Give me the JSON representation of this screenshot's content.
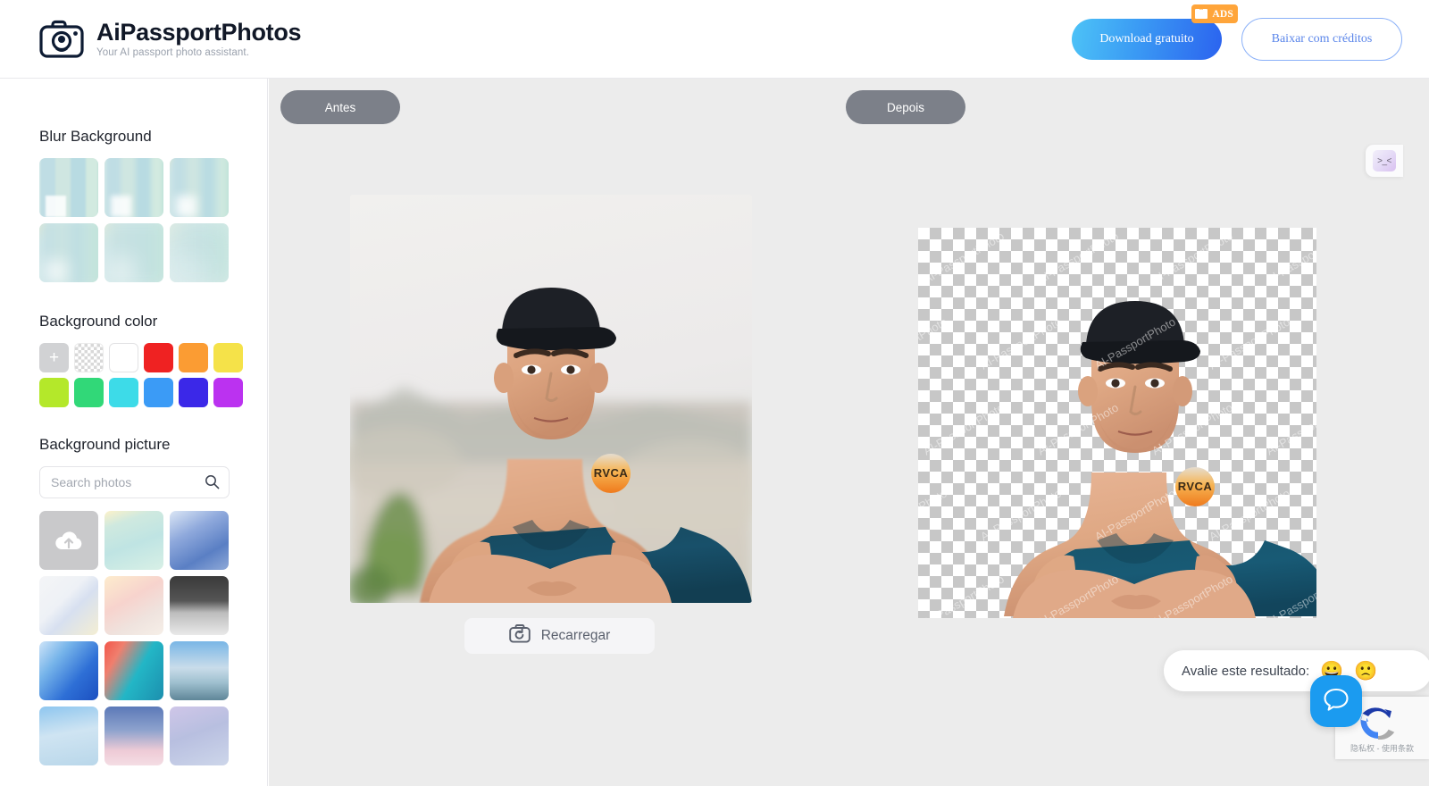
{
  "header": {
    "brand_title": "AiPassportPhotos",
    "brand_subtitle": "Your AI passport photo assistant.",
    "logo_icon": "camera-icon",
    "download_free_label": "Download gratuito",
    "ads_badge_label": "ADS",
    "ads_badge_icon": "tv-icon",
    "download_credits_label": "Baixar com créditos",
    "accent_gradient_from": "#4dc3f7",
    "accent_gradient_to": "#2b63ef",
    "credits_border_color": "#8ab0f8",
    "ads_badge_color": "#ffa53a"
  },
  "sidebar": {
    "blur": {
      "title": "Blur Background",
      "thumbs": [
        {
          "name": "blur-level-1",
          "blur": "1px"
        },
        {
          "name": "blur-level-2",
          "blur": "3px"
        },
        {
          "name": "blur-level-3",
          "blur": "5px"
        },
        {
          "name": "blur-level-4",
          "blur": "9px"
        },
        {
          "name": "blur-level-5",
          "blur": "13px"
        },
        {
          "name": "blur-level-6",
          "blur": "18px"
        }
      ]
    },
    "background_color": {
      "title": "Background color",
      "add_label": "+",
      "swatches": [
        {
          "name": "add-custom-color",
          "type": "add",
          "color": "#d1d2d4"
        },
        {
          "name": "transparent",
          "type": "transparent",
          "color": "transparent"
        },
        {
          "name": "white",
          "type": "solid",
          "color": "#ffffff"
        },
        {
          "name": "red",
          "type": "solid",
          "color": "#ef2222"
        },
        {
          "name": "orange",
          "type": "solid",
          "color": "#fb9c33"
        },
        {
          "name": "yellow",
          "type": "solid",
          "color": "#f5e249"
        },
        {
          "name": "lime",
          "type": "solid",
          "color": "#b4e82a"
        },
        {
          "name": "green",
          "type": "solid",
          "color": "#31d878"
        },
        {
          "name": "cyan",
          "type": "solid",
          "color": "#3ddbe8"
        },
        {
          "name": "blue",
          "type": "solid",
          "color": "#3b9bf6"
        },
        {
          "name": "indigo",
          "type": "solid",
          "color": "#3b28e8"
        },
        {
          "name": "magenta",
          "type": "solid",
          "color": "#bb32f0"
        }
      ]
    },
    "background_picture": {
      "title": "Background picture",
      "search_placeholder": "Search photos",
      "search_value": "",
      "search_icon": "magnifier-icon",
      "upload_icon": "cloud-upload-icon",
      "pictures": [
        {
          "name": "upload-tile",
          "type": "upload"
        },
        {
          "name": "pastel-mint-texture",
          "type": "image",
          "css": "linear-gradient(160deg,#fdf2c9 0%,#cfe9df 22%,#bfe4e3 55%,#d8f0e6 100%)"
        },
        {
          "name": "blue-watercolor",
          "type": "image",
          "css": "linear-gradient(150deg,#dbe6f5 0%,#8fa9dc 35%,#5a7fc4 70%,#8fa9d8 100%)"
        },
        {
          "name": "cream-paper-abstract",
          "type": "image",
          "css": "linear-gradient(135deg,#f4f5f7 0%,#eef1f6 40%,#d7e0f0 58%,#f4eed3 100%)"
        },
        {
          "name": "pink-clouds",
          "type": "image",
          "css": "linear-gradient(150deg,#fdeccd 0%,#f7d3cd 40%,#efe3de 70%,#f6efe8 100%)"
        },
        {
          "name": "dark-grain-gradient",
          "type": "image",
          "css": "linear-gradient(180deg,#3a3a3a 0%,#555 42%,#bcbcbc 62%,#e9e9e9 100%)"
        },
        {
          "name": "blue-ink-wash",
          "type": "image",
          "css": "linear-gradient(130deg,#cfe4f8 0%,#76b4ea 30%,#2e6fd6 65%,#1b4fc0 100%)"
        },
        {
          "name": "coral-teal-paint",
          "type": "image",
          "css": "linear-gradient(120deg,#f2574b 0%,#f07f6e 22%,#23b6c6 55%,#1c8fae 100%)"
        },
        {
          "name": "sky-clouds-lake",
          "type": "image",
          "css": "linear-gradient(180deg,#79b6e6 0%,#c9dcea 45%,#9fc0cf 70%,#5f8698 100%)"
        },
        {
          "name": "rainbow-sky",
          "type": "image",
          "css": "linear-gradient(170deg,#8ec6ef 0%,#cfe4f2 45%,#b9d7ea 100%)"
        },
        {
          "name": "pink-cloud-dusk",
          "type": "image",
          "css": "linear-gradient(180deg,#5c79b8 0%,#8da2cd 40%,#eecbd6 75%,#f4dde4 100%)"
        },
        {
          "name": "moon-purple-sky",
          "type": "image",
          "css": "linear-gradient(160deg,#cfc6e8 0%,#b8bfe0 45%,#cdd6ea 100%)"
        }
      ]
    }
  },
  "canvas": {
    "tab_before_label": "Antes",
    "tab_after_label": "Depois",
    "reload_label": "Recarregar",
    "reload_icon": "camera-refresh-icon",
    "before_image_alt": "Young man in dark teal sleeveless shirt with cap, arms crossed, blurred city background",
    "after_image_alt": "Same man with background removed on transparency checkerboard",
    "watermark_text": "AI-PassportPhoto",
    "corner_widget": {
      "name": "collapse-panel-widget",
      "face": ">_<"
    }
  },
  "feedback": {
    "prompt": "Avalie este resultado:",
    "happy_icon": "happy-face-emoji",
    "sad_icon": "sad-face-emoji",
    "happy_glyph": "😀",
    "sad_glyph": "🙁",
    "chat_icon": "chat-bubble-icon",
    "chat_color": "#1b9bf0"
  },
  "recaptcha": {
    "terms": "隐私权 - 使用条款",
    "logo_icon": "recaptcha-icon"
  }
}
